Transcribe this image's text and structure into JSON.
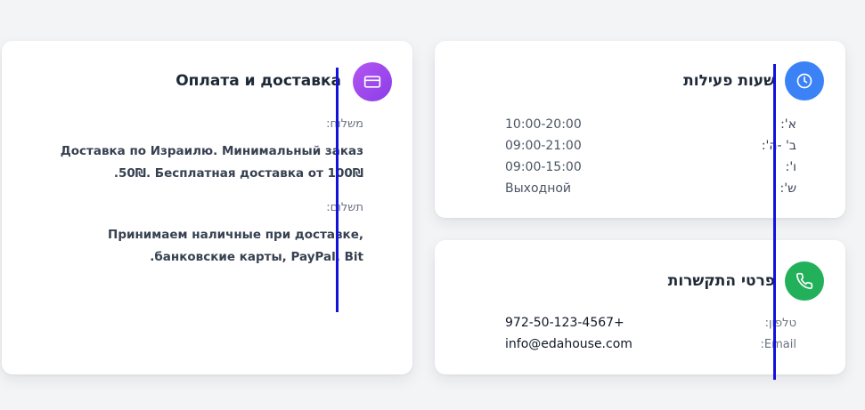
{
  "payment": {
    "title": "Оплата и доставка",
    "icon": "credit-card-icon",
    "delivery_label": "משלוח:",
    "delivery_line1": "Доставка по Израилю. Минимальный заказ",
    "delivery_line2": ".50₪. Бесплатная доставка от 100₪",
    "payment_label": "תשלום:",
    "payment_line1": "Принимаем наличные при доставке,",
    "payment_line2": ".банковские карты, PayPal, Bit"
  },
  "hours": {
    "title": "שעות פעילות",
    "icon": "clock-icon",
    "rows": [
      {
        "day": "א':",
        "time": "10:00-20:00"
      },
      {
        "day": "ב' -ה':",
        "time": "09:00-21:00"
      },
      {
        "day": "ו':",
        "time": "09:00-15:00"
      },
      {
        "day": "ש':",
        "time": "Выходной"
      }
    ]
  },
  "contact": {
    "title": "פרטי התקשרות",
    "icon": "phone-icon",
    "phone_label": "טלפון:",
    "phone_value": "972-50-123-4567+",
    "email_label": "Email:",
    "email_value": "info@edahouse.com"
  },
  "colors": {
    "payment_icon_bg": "#a64bf0",
    "hours_icon_bg": "#3b82f6",
    "contact_icon_bg": "#22b15a",
    "overlay_line": "#1212dd"
  }
}
